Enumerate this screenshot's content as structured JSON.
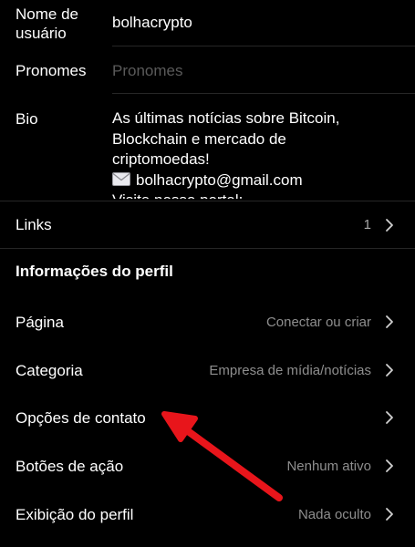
{
  "username": {
    "label_line1": "Nome de",
    "label_line2": "usuário",
    "value": "bolhacrypto"
  },
  "pronouns": {
    "label": "Pronomes",
    "placeholder": "Pronomes"
  },
  "bio": {
    "label": "Bio",
    "lines": [
      "As últimas notícias sobre Bitcoin,",
      "Blockchain e mercado de",
      "criptomoedas!",
      "bolhacrypto@gmail.com",
      "Visite nosso portal:"
    ],
    "email_icon": "envelope-icon"
  },
  "links": {
    "label": "Links",
    "count": "1"
  },
  "profile_section": {
    "title": "Informações do perfil"
  },
  "rows": [
    {
      "label": "Página",
      "value": "Conectar ou criar"
    },
    {
      "label": "Categoria",
      "value": "Empresa de mídia/notícias"
    },
    {
      "label": "Opções de contato",
      "value": ""
    },
    {
      "label": "Botões de ação",
      "value": "Nenhum ativo"
    },
    {
      "label": "Exibição do perfil",
      "value": "Nada oculto"
    }
  ],
  "annotation": {
    "arrow_color": "#e8151b",
    "icon": "red-arrow-icon"
  },
  "colors": {
    "background": "#000000",
    "text": "#ffffff",
    "secondary": "#8e8e8e",
    "divider": "#262626"
  }
}
